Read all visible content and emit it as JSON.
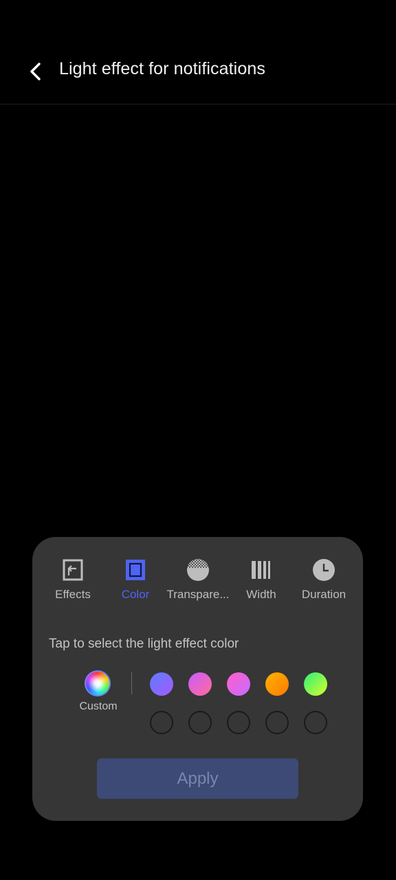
{
  "header": {
    "title": "Light effect for notifications"
  },
  "tabs": [
    {
      "label": "Effects"
    },
    {
      "label": "Color"
    },
    {
      "label": "Transpare..."
    },
    {
      "label": "Width"
    },
    {
      "label": "Duration"
    }
  ],
  "active_tab": "Color",
  "instruction": "Tap to select the light effect color",
  "custom": {
    "label": "Custom"
  },
  "colors": {
    "accent": "#4f63f5",
    "swatches": [
      [
        "#5b7cff",
        "#a65bff"
      ],
      [
        "#c95cff",
        "#ff6b9a"
      ],
      [
        "#ff5fc8",
        "#c76bff"
      ],
      [
        "#ffb300",
        "#ff7a00"
      ],
      [
        "#2cf07a",
        "#d8ff2a"
      ]
    ]
  },
  "apply": {
    "label": "Apply"
  }
}
